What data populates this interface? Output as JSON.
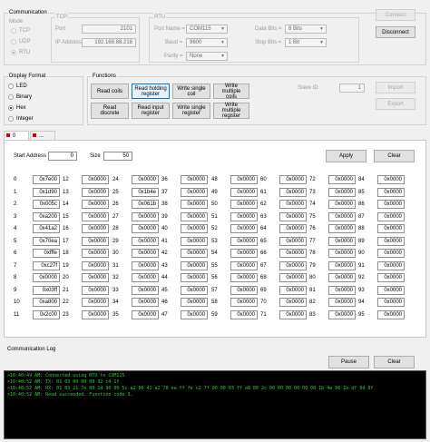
{
  "communication": {
    "title": "Communication",
    "mode": {
      "label": "Mode",
      "options": [
        "TCP",
        "UDP",
        "RTU"
      ],
      "selected": "RTU"
    },
    "tcp": {
      "title": "TCP",
      "port_label": "Port",
      "port_value": "2101",
      "ip_label": "IP Address",
      "ip_value": "192.168.88.218"
    },
    "rtu": {
      "title": "RTU",
      "port_name_label": "Port Name =",
      "port_name_value": "COM115",
      "baud_label": "Baud =",
      "baud_value": "9600",
      "parity_label": "Parity =",
      "parity_value": "None",
      "data_bits_label": "Data Bits =",
      "data_bits_value": "8 Bits",
      "stop_bits_label": "Stop Bits =",
      "stop_bits_value": "1 Bit"
    },
    "connect_label": "Connect",
    "disconnect_label": "Disconnect"
  },
  "display_format": {
    "title": "Display Format",
    "options": [
      "LED",
      "Binary",
      "Hex",
      "Integer"
    ],
    "selected": "Hex"
  },
  "functions": {
    "title": "Functions",
    "buttons": [
      "Read coils",
      "Read holding\nregister",
      "Write single\ncoil",
      "Write multiple\ncoils",
      "Read\ndiscrete",
      "Read input\nregister",
      "Write single\nregister",
      "Write multiple\nregister"
    ],
    "slave_id_label": "Slave ID",
    "slave_id_value": "1",
    "import_label": "Import",
    "export_label": "Export"
  },
  "tabs": [
    "0",
    "..."
  ],
  "registers": {
    "start_address_label": "Start Address",
    "start_address_value": "0",
    "size_label": "Size",
    "size_value": "50",
    "apply_label": "Apply",
    "clear_label": "Clear",
    "columns": [
      {
        "indices": [
          "0",
          "1",
          "2",
          "3",
          "4",
          "5",
          "6",
          "7",
          "8",
          "9",
          "10",
          "11"
        ],
        "values": [
          "0x7e00",
          "0x1d90",
          "0x005c",
          "0xa200",
          "0x41a2",
          "0x70ea",
          "0xfffe",
          "0xc27f",
          "0x0000",
          "0x03ff",
          "0xa800",
          "0x2c00"
        ]
      },
      {
        "indices": [
          "12",
          "13",
          "14",
          "15",
          "16",
          "17",
          "18",
          "19",
          "20",
          "21",
          "22",
          "23"
        ],
        "values": [
          "0x0000",
          "0x0000",
          "0x0000",
          "0x0000",
          "0x0000",
          "0x0000",
          "0x0000",
          "0x0000",
          "0x0000",
          "0x0000",
          "0x0000",
          "0x0000"
        ]
      },
      {
        "indices": [
          "24",
          "25",
          "26",
          "27",
          "28",
          "29",
          "30",
          "31",
          "32",
          "33",
          "34",
          "35"
        ],
        "values": [
          "0x0000",
          "0x1b4e",
          "0x061b",
          "0x0000",
          "0x0000",
          "0x0000",
          "0x0000",
          "0x0000",
          "0x0000",
          "0x0000",
          "0x0000",
          "0x0000"
        ]
      },
      {
        "indices": [
          "36",
          "37",
          "38",
          "39",
          "40",
          "41",
          "42",
          "43",
          "44",
          "45",
          "46",
          "47"
        ],
        "values": [
          "0x0000",
          "0x0000",
          "0x0000",
          "0x0000",
          "0x0000",
          "0x0000",
          "0x0000",
          "0x0000",
          "0x0000",
          "0x0000",
          "0x0000",
          "0x0000"
        ]
      },
      {
        "indices": [
          "48",
          "49",
          "50",
          "51",
          "52",
          "53",
          "54",
          "55",
          "56",
          "57",
          "58",
          "59"
        ],
        "values": [
          "0x0000",
          "0x0000",
          "0x0000",
          "0x0000",
          "0x0000",
          "0x0000",
          "0x0000",
          "0x0000",
          "0x0000",
          "0x0000",
          "0x0000",
          "0x0000"
        ]
      },
      {
        "indices": [
          "60",
          "61",
          "62",
          "63",
          "64",
          "65",
          "66",
          "67",
          "68",
          "69",
          "70",
          "71"
        ],
        "values": [
          "0x0000",
          "0x0000",
          "0x0000",
          "0x0000",
          "0x0000",
          "0x0000",
          "0x0000",
          "0x0000",
          "0x0000",
          "0x0000",
          "0x0000",
          "0x0000"
        ]
      },
      {
        "indices": [
          "72",
          "73",
          "74",
          "75",
          "76",
          "77",
          "78",
          "79",
          "80",
          "81",
          "82",
          "83"
        ],
        "values": [
          "0x0000",
          "0x0000",
          "0x0000",
          "0x0000",
          "0x0000",
          "0x0000",
          "0x0000",
          "0x0000",
          "0x0000",
          "0x0000",
          "0x0000",
          "0x0000"
        ]
      },
      {
        "indices": [
          "84",
          "85",
          "86",
          "87",
          "88",
          "89",
          "90",
          "91",
          "92",
          "93",
          "94",
          "95"
        ],
        "values": [
          "0x0000",
          "0x0000",
          "0x0000",
          "0x0000",
          "0x0000",
          "0x0000",
          "0x0000",
          "0x0000",
          "0x0000",
          "0x0000",
          "0x0000",
          "0x0000"
        ]
      }
    ]
  },
  "communication_log": {
    "title": "Communication Log",
    "pause_label": "Pause",
    "clear_label": "Clear",
    "lines": [
      ">10:40:49 AM: Connected using RTU to COM115",
      ">10:40:52 AM: TX: 01 03 00 00 00 32 c4 1f",
      ">10:40:52 AM: RX: 01 03 21 7e 00 1d 90 00 5c a2 00 41 a2 70 ea ff fe c2 7f 00 00 03 ff a8 00 2c 00 00 00 00 00 00 1b 4e 06 1b df 0d 8f",
      ">10:40:52 AM: Read succeeded. Function code 3."
    ]
  }
}
